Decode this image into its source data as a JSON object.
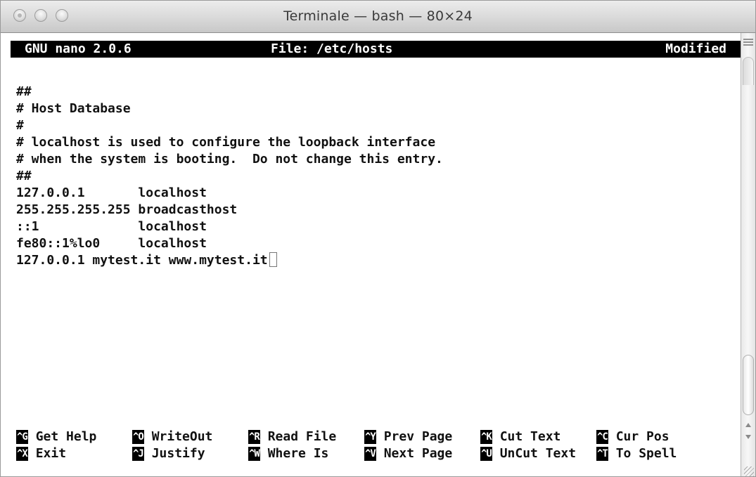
{
  "window": {
    "title": "Terminale — bash — 80×24"
  },
  "nano": {
    "version": "GNU nano 2.0.6",
    "file": "File: /etc/hosts",
    "status": "Modified"
  },
  "file_lines": [
    "##",
    "# Host Database",
    "#",
    "# localhost is used to configure the loopback interface",
    "# when the system is booting.  Do not change this entry.",
    "##",
    "127.0.0.1       localhost",
    "255.255.255.255 broadcasthost",
    "::1             localhost",
    "fe80::1%lo0     localhost",
    "127.0.0.1 mytest.it www.mytest.it"
  ],
  "shortcuts_row1": [
    {
      "key": "^G",
      "label": "Get Help"
    },
    {
      "key": "^O",
      "label": "WriteOut"
    },
    {
      "key": "^R",
      "label": "Read File"
    },
    {
      "key": "^Y",
      "label": "Prev Page"
    },
    {
      "key": "^K",
      "label": "Cut Text"
    },
    {
      "key": "^C",
      "label": "Cur Pos"
    }
  ],
  "shortcuts_row2": [
    {
      "key": "^X",
      "label": "Exit"
    },
    {
      "key": "^J",
      "label": "Justify"
    },
    {
      "key": "^W",
      "label": "Where Is"
    },
    {
      "key": "^V",
      "label": "Next Page"
    },
    {
      "key": "^U",
      "label": "UnCut Text"
    },
    {
      "key": "^T",
      "label": "To Spell"
    }
  ]
}
